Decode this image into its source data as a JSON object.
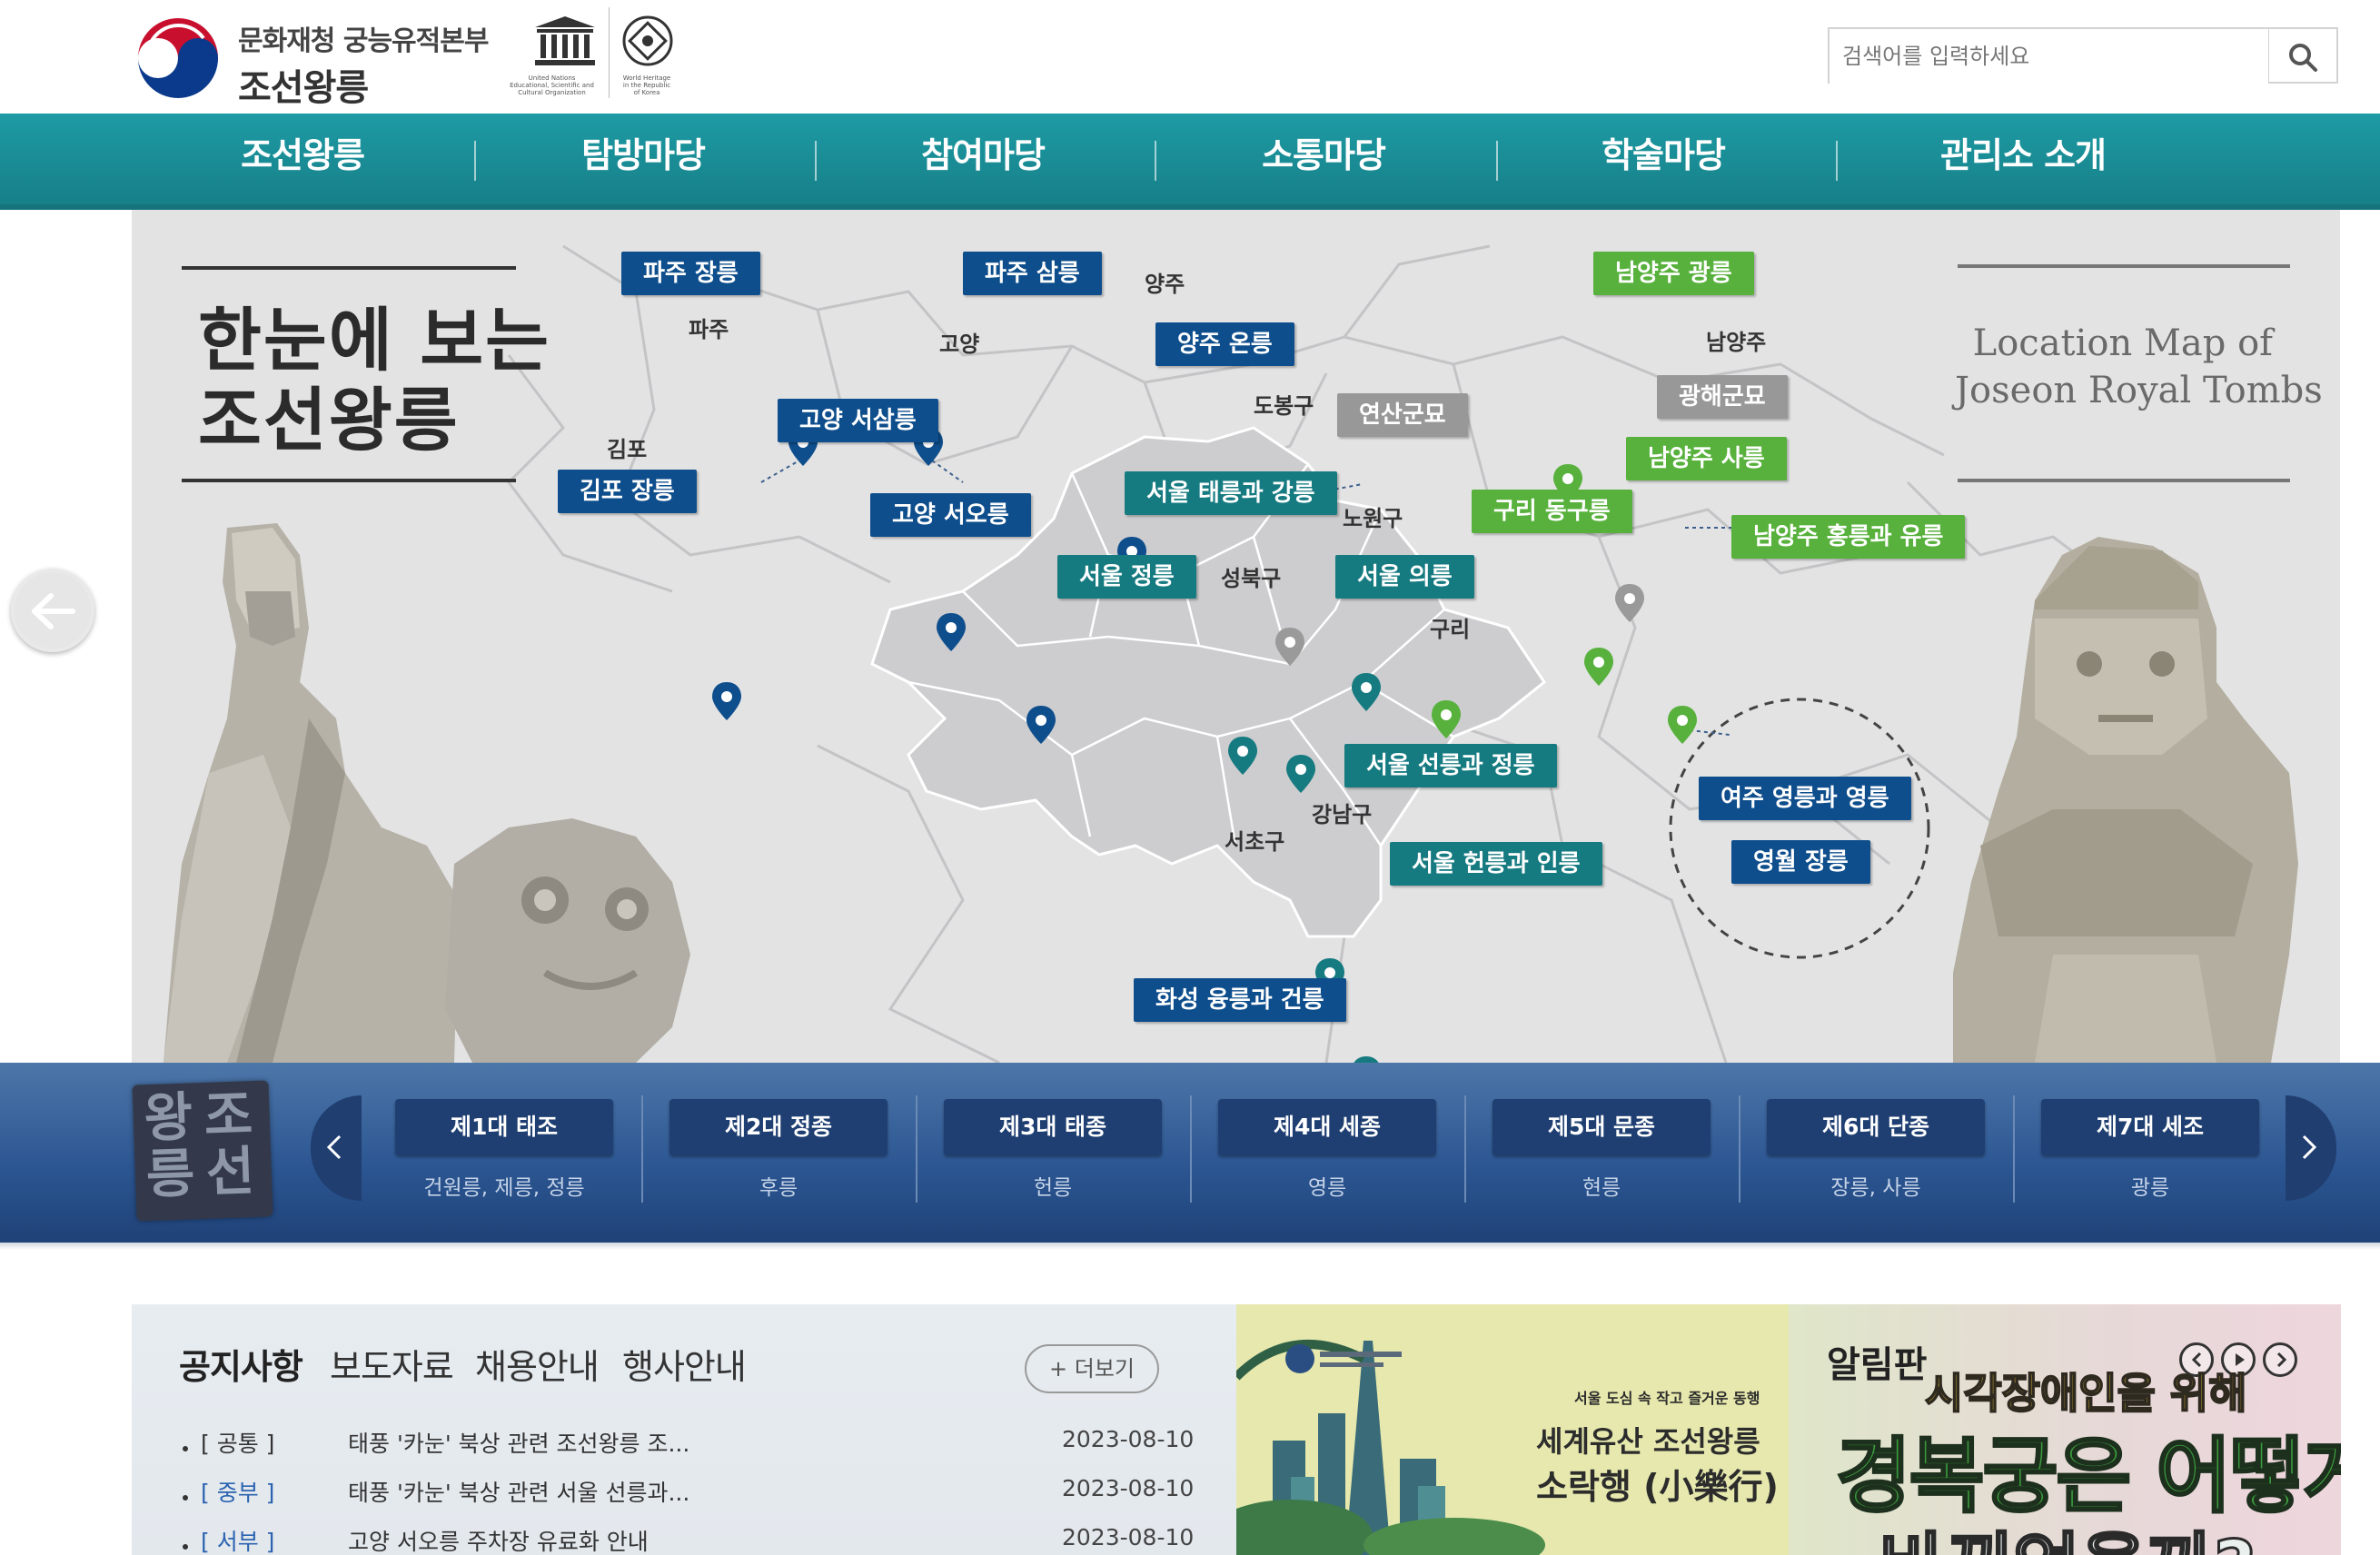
{
  "header": {
    "org_name": "문화재청 궁능유적본부",
    "site_title": "조선왕릉",
    "unesco_text": [
      "United Nations",
      "Educational, Scientific and",
      "Cultural Organization"
    ],
    "heritage_text": [
      "World Heritage",
      "in the Republic",
      "of Korea"
    ],
    "search_placeholder": "검색어를 입력하세요"
  },
  "nav": {
    "items": [
      "조선왕릉",
      "탐방마당",
      "참여마당",
      "소통마당",
      "학술마당",
      "관리소 소개"
    ]
  },
  "hero": {
    "title_line1": "한눈에 보는",
    "title_line2": "조선왕릉",
    "en_title_line1": "Location Map of",
    "en_title_line2": "Joseon Royal Tombs",
    "tags": [
      {
        "label": "파주 장릉",
        "color": "blue"
      },
      {
        "label": "파주 삼릉",
        "color": "blue"
      },
      {
        "label": "양주 온릉",
        "color": "blue"
      },
      {
        "label": "고양 서삼릉",
        "color": "blue"
      },
      {
        "label": "김포 장릉",
        "color": "blue"
      },
      {
        "label": "고양 서오릉",
        "color": "blue"
      },
      {
        "label": "서울 태릉과 강릉",
        "color": "teal"
      },
      {
        "label": "서울 정릉",
        "color": "teal"
      },
      {
        "label": "서울 의릉",
        "color": "teal"
      },
      {
        "label": "연산군묘",
        "color": "gray"
      },
      {
        "label": "광해군묘",
        "color": "gray"
      },
      {
        "label": "남양주 광릉",
        "color": "green"
      },
      {
        "label": "남양주 사릉",
        "color": "green"
      },
      {
        "label": "구리 동구릉",
        "color": "green"
      },
      {
        "label": "남양주 홍릉과 유릉",
        "color": "green"
      },
      {
        "label": "서울 선릉과 정릉",
        "color": "teal"
      },
      {
        "label": "서울 헌릉과 인릉",
        "color": "teal"
      },
      {
        "label": "화성 융릉과 건릉",
        "color": "blue"
      },
      {
        "label": "여주 영릉과 영릉",
        "color": "blue"
      },
      {
        "label": "영월 장릉",
        "color": "blue"
      }
    ],
    "places": [
      "양주",
      "파주",
      "고양",
      "김포",
      "도봉구",
      "남양주",
      "노원구",
      "성북구",
      "구리",
      "강남구",
      "서초구"
    ]
  },
  "kings": [
    {
      "name": "제1대 태조",
      "tombs": "건원릉, 제릉, 정릉"
    },
    {
      "name": "제2대 정종",
      "tombs": "후릉"
    },
    {
      "name": "제3대 태종",
      "tombs": "헌릉"
    },
    {
      "name": "제4대 세종",
      "tombs": "영릉"
    },
    {
      "name": "제5대 문종",
      "tombs": "현릉"
    },
    {
      "name": "제6대 단종",
      "tombs": "장릉, 사릉"
    },
    {
      "name": "제7대 세조",
      "tombs": "광릉"
    }
  ],
  "seal": [
    "조",
    "선",
    "왕",
    "릉"
  ],
  "notice": {
    "tabs": [
      "공지사항",
      "보도자료",
      "채용안내",
      "행사안내"
    ],
    "more_label": "+ 더보기",
    "rows": [
      {
        "cat": "[ 공통 ]",
        "title": "태풍 '카눈' 북상 관련 조선왕릉 조...",
        "date": "2023-08-10"
      },
      {
        "cat": "[ 중부 ]",
        "title": "태풍 '카눈' 북상 관련 서울 선릉과...",
        "date": "2023-08-10"
      },
      {
        "cat": "[ 서부 ]",
        "title": "고양 서오릉 주차장 유료화 안내",
        "date": "2023-08-10"
      }
    ]
  },
  "banner1": {
    "small_text": "서울 도심 속 작고 즐거운 동행",
    "line1": "세계유산 조선왕릉",
    "line2": "소락행 (小樂行)"
  },
  "board": {
    "title": "알림판",
    "line1": "시각장애인을 위해",
    "line2": "경복궁은 어떻게",
    "line3": "바뀌었을까?"
  },
  "colors": {
    "nav": "#1a8f98",
    "tag_blue": "#0e4e8c",
    "tag_teal": "#167b81",
    "tag_green": "#57b13c",
    "tag_gray": "#989898",
    "strip": "#2b5591"
  },
  "icons": [
    "search-icon",
    "arrow-left-icon",
    "chevron-left-icon",
    "chevron-right-icon",
    "map-pin-icon",
    "pause-icon",
    "play-icon"
  ]
}
